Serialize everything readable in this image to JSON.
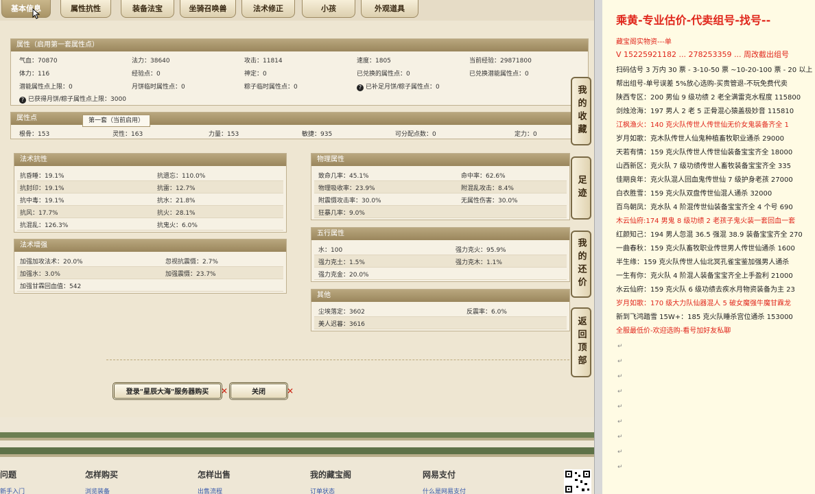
{
  "tabs": [
    "基本信息",
    "属性抗性",
    "装备法宝",
    "坐骑召唤兽",
    "法术修正",
    "小孩",
    "外观道具"
  ],
  "attr_panel": {
    "title": "属性（启用第一套属性点）",
    "fields": [
      "气血：70870",
      "法力：38640",
      "攻击：11814",
      "速度：1805",
      "当前经验：29871800",
      "体力：116",
      "经验点：0",
      "神定：0",
      "已兑换的属性点：0",
      "已兑换潜能属性点：0",
      "潜能属性点上限：0",
      "月饼临时属性点：0",
      "粽子临时属性点：0",
      "已补足月饼/粽子属性点：0"
    ],
    "note": "已获得月饼/粽子属性点上限：3000"
  },
  "points_panel": {
    "title": "属性点",
    "subtab": "第一套（当前启用）",
    "fields": [
      "根骨：153",
      "灵性：163",
      "力量：153",
      "敏捷：935",
      "可分配点数：0",
      "定力：0"
    ]
  },
  "resist_panel": {
    "title": "法术抗性",
    "rows": [
      [
        "抗昏睡：19.1%",
        "抗遗忘：110.0%"
      ],
      [
        "抗封印：19.1%",
        "抗雷：12.7%"
      ],
      [
        "抗中毒：19.1%",
        "抗水：21.8%"
      ],
      [
        "抗风：17.7%",
        "抗火：28.1%"
      ],
      [
        "抗混乱：126.3%",
        "抗鬼火：6.0%"
      ]
    ]
  },
  "enhance_panel": {
    "title": "法术增强",
    "rows": [
      [
        "加强加攻法术：20.0%",
        "忽视抗震慑：2.7%"
      ],
      [
        "加强水：3.0%",
        "加强震慑：23.7%"
      ],
      [
        "加强甘霖回血值：542",
        ""
      ]
    ]
  },
  "phys_panel": {
    "title": "物理属性",
    "rows": [
      [
        "致命几率：45.1%",
        "命中率：62.6%"
      ],
      [
        "物理吸收率：23.9%",
        "附混乱攻击：8.4%"
      ],
      [
        "附震慑攻击率：30.0%",
        "无属性伤害：30.0%"
      ],
      [
        "狂暴几率：9.0%",
        ""
      ]
    ]
  },
  "wuxing_panel": {
    "title": "五行属性",
    "rows": [
      [
        "水：100",
        "强力克火：95.9%"
      ],
      [
        "强力克土：1.5%",
        "强力克木：1.1%"
      ],
      [
        "强力克金：20.0%",
        ""
      ]
    ]
  },
  "other_panel": {
    "title": "其他",
    "rows": [
      [
        "尘埃落定：3602",
        "反震率：6.0%"
      ],
      [
        "美人迟暮：3616",
        ""
      ]
    ]
  },
  "buttons": {
    "buy": "登录\"星辰大海\"服务器购买",
    "close": "关闭"
  },
  "side_buttons": [
    "我的收藏",
    "足迹",
    "我的还价",
    "返回顶部"
  ],
  "footer": {
    "columns": [
      "问题",
      "怎样购买",
      "怎样出售",
      "我的藏宝阁",
      "网易支付"
    ],
    "links": [
      "新手入门",
      "浏览装备",
      "出售流程",
      "订单状态",
      "什么是网易支付"
    ]
  },
  "notes": {
    "title": "乘黄-专业估价-代卖组号-找号--",
    "lines": [
      {
        "text": "藏宝阁实物资---单",
        "red": true
      },
      {
        "text": "V 15225921182 ... 278253359 ... 周改截出组号",
        "red": true
      },
      {
        "text": "扫码估号 3 万内 30 票 - 3-10-50 票 ~10-20-100 票 - 20 以上",
        "red": false
      },
      {
        "text": "帮出组号-单号误差 5%放心选购-买贵管退-不玩免费代卖",
        "red": false
      },
      {
        "text": "陕西专区：200 男仙 9 级功绩 2 老全满雷克水程度 115800",
        "red": false
      },
      {
        "text": "剑烛沧海：197 男人 2 老 5 正骨混心猿盖极妙音 115810",
        "red": false
      },
      {
        "text": "江枫渔火：140 克火队传世人传世仙无价女鬼装备齐全 1",
        "red": true
      },
      {
        "text": "岁月如歌：克木队传世人仙鬼种植畜牧职业通杀 29000",
        "red": false
      },
      {
        "text": "天若有情：159 克火队传世人传世仙装备宝宝齐全 18000",
        "red": false
      },
      {
        "text": "山西新区：克火队 7 级功绩传世人畜牧装备宝宝齐全 335",
        "red": false
      },
      {
        "text": "佳期良年：克火队混人回血鬼传世仙 7 级护身老孩 27000",
        "red": false
      },
      {
        "text": "白衣胜雪：159 克火队双盘传世仙混人通杀 32000",
        "red": false
      },
      {
        "text": "百鸟朝凤：克水队 4 阶混传世仙装备宝宝齐全 4 个号 690",
        "red": false
      },
      {
        "text": "木云仙府:174 男鬼 8 级功绩 2 老孩子鬼火装一套回血一套",
        "red": true
      },
      {
        "text": "红颜知己：194 男人忽混 36.5 强混 38.9 装备宝宝齐全 270",
        "red": false
      },
      {
        "text": "一曲春秋：159 克火队畜牧职业传世男人传世仙通杀 1600",
        "red": false
      },
      {
        "text": "半生缘：159 克火队传世人仙北冥孔雀宝鉴加强男人通杀",
        "red": false
      },
      {
        "text": "一生有你：克火队 4 阶混人装备宝宝齐全上手盈利 21000",
        "red": false
      },
      {
        "text": "水云仙府：159 克火队 6 级功绩去疾水月物资装备为主 23",
        "red": false
      },
      {
        "text": "岁月如歌：170 级大力队仙器混人 5 破女魔强牛魔甘霖龙",
        "red": true
      },
      {
        "text": "新到飞鸿踏雪 15W+：185 克火队睡杀宫位通杀 153000",
        "red": false
      },
      {
        "text": "全服最低价-欢迎选购-看号加好友私聊",
        "red": true
      }
    ]
  }
}
